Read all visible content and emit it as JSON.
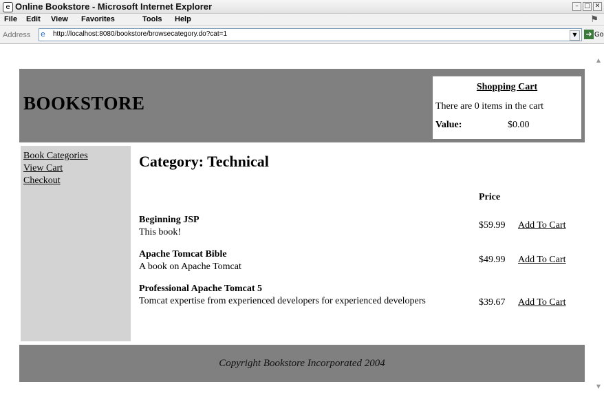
{
  "window": {
    "title": "Online Bookstore - Microsoft Internet Explorer",
    "app_icon": "ie-icon",
    "buttons": [
      "minimize",
      "maximize",
      "close"
    ]
  },
  "menu": {
    "items": [
      "File",
      "Edit",
      "View",
      "Favorites",
      "Tools",
      "Help"
    ]
  },
  "address": {
    "label": "Address",
    "url": "http://localhost:8080/bookstore/browsecategory.do?cat=1",
    "go_label": "Go"
  },
  "page": {
    "logo": "BOOKSTORE",
    "cart": {
      "title": "Shopping Cart",
      "count_text": "There are 0 items in the cart",
      "value_label": "Value:",
      "value_amount": "$0.00"
    },
    "nav": [
      "Book Categories",
      "View Cart",
      "Checkout"
    ],
    "category_title": "Category: Technical",
    "price_header": "Price",
    "books": [
      {
        "name": "Beginning JSP",
        "description": "This book!",
        "price": "$59.99",
        "action": "Add To Cart"
      },
      {
        "name": "Apache Tomcat Bible",
        "description": "A book on Apache Tomcat",
        "price": "$49.99",
        "action": "Add To Cart"
      },
      {
        "name": "Professional Apache Tomcat 5",
        "description": "Tomcat expertise from experienced developers for experienced developers",
        "price": "$39.67",
        "action": "Add To Cart"
      }
    ],
    "footer": "Copyright Bookstore Incorporated 2004"
  },
  "colors": {
    "header_bg": "#808080",
    "sidebar_bg": "#d3d3d3"
  }
}
